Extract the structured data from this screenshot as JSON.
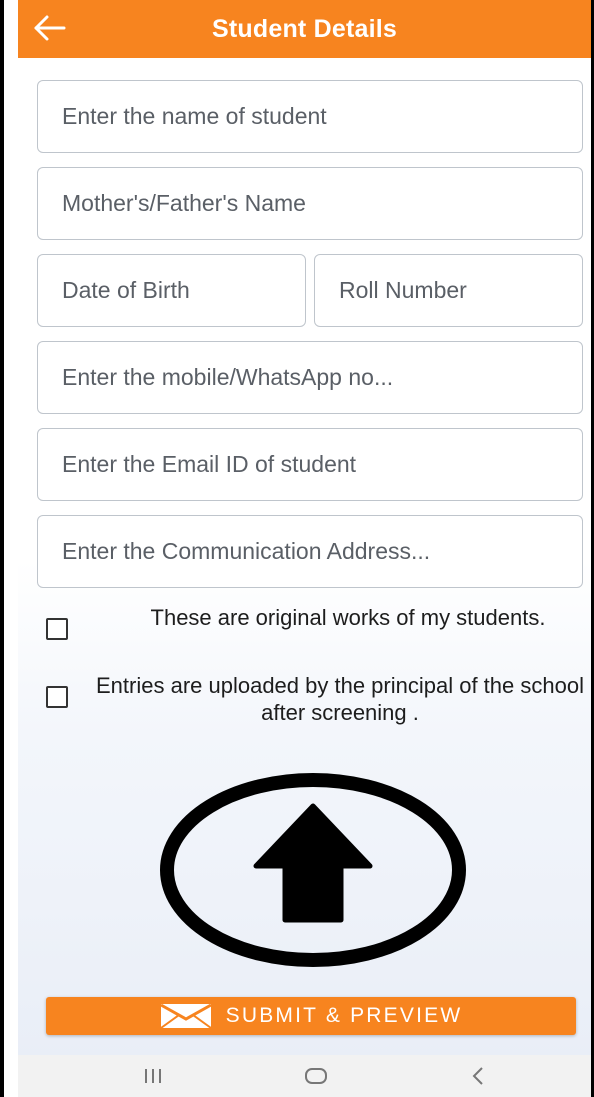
{
  "app_bar": {
    "title": "Student Details",
    "back_icon": "arrow-left-icon",
    "background": "#f7841f"
  },
  "form": {
    "student_name_placeholder": "Enter the name of student",
    "parent_name_placeholder": "Mother's/Father's Name",
    "dob_placeholder": "Date of Birth",
    "roll_number_placeholder": "Roll Number",
    "mobile_placeholder": "Enter the mobile/WhatsApp no...",
    "email_placeholder": "Enter the Email ID of student",
    "address_placeholder": "Enter the Communication Address..."
  },
  "declarations": {
    "original_works": {
      "label": "These are original works of my students.",
      "checked": false
    },
    "principal_upload": {
      "label": "Entries are uploaded by the principal of the school after screening .",
      "checked": false
    }
  },
  "upload": {
    "icon": "upload-arrow-icon"
  },
  "submit": {
    "label": "SUBMIT & PREVIEW",
    "icon": "mail-icon",
    "color": "#f7841f"
  },
  "system_nav": {
    "recents_icon": "recents-icon",
    "home_icon": "home-icon",
    "back_icon": "nav-back-icon"
  }
}
